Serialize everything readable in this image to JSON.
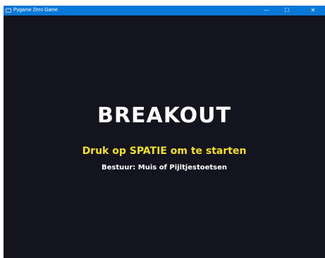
{
  "window": {
    "title": "Pygame Zero Game",
    "minimize_glyph": "—",
    "maximize_glyph": "☐",
    "close_glyph": "✕",
    "titlebar_color": "#0a78d7",
    "icon": "pygame-window-icon"
  },
  "game": {
    "background_color": "#14141f",
    "title": "BREAKOUT",
    "start_hint": "Druk op SPATIE om te starten",
    "start_hint_color": "#f5e11e",
    "controls_hint": "Bestuur: Muis of Pijltjestoetsen"
  }
}
